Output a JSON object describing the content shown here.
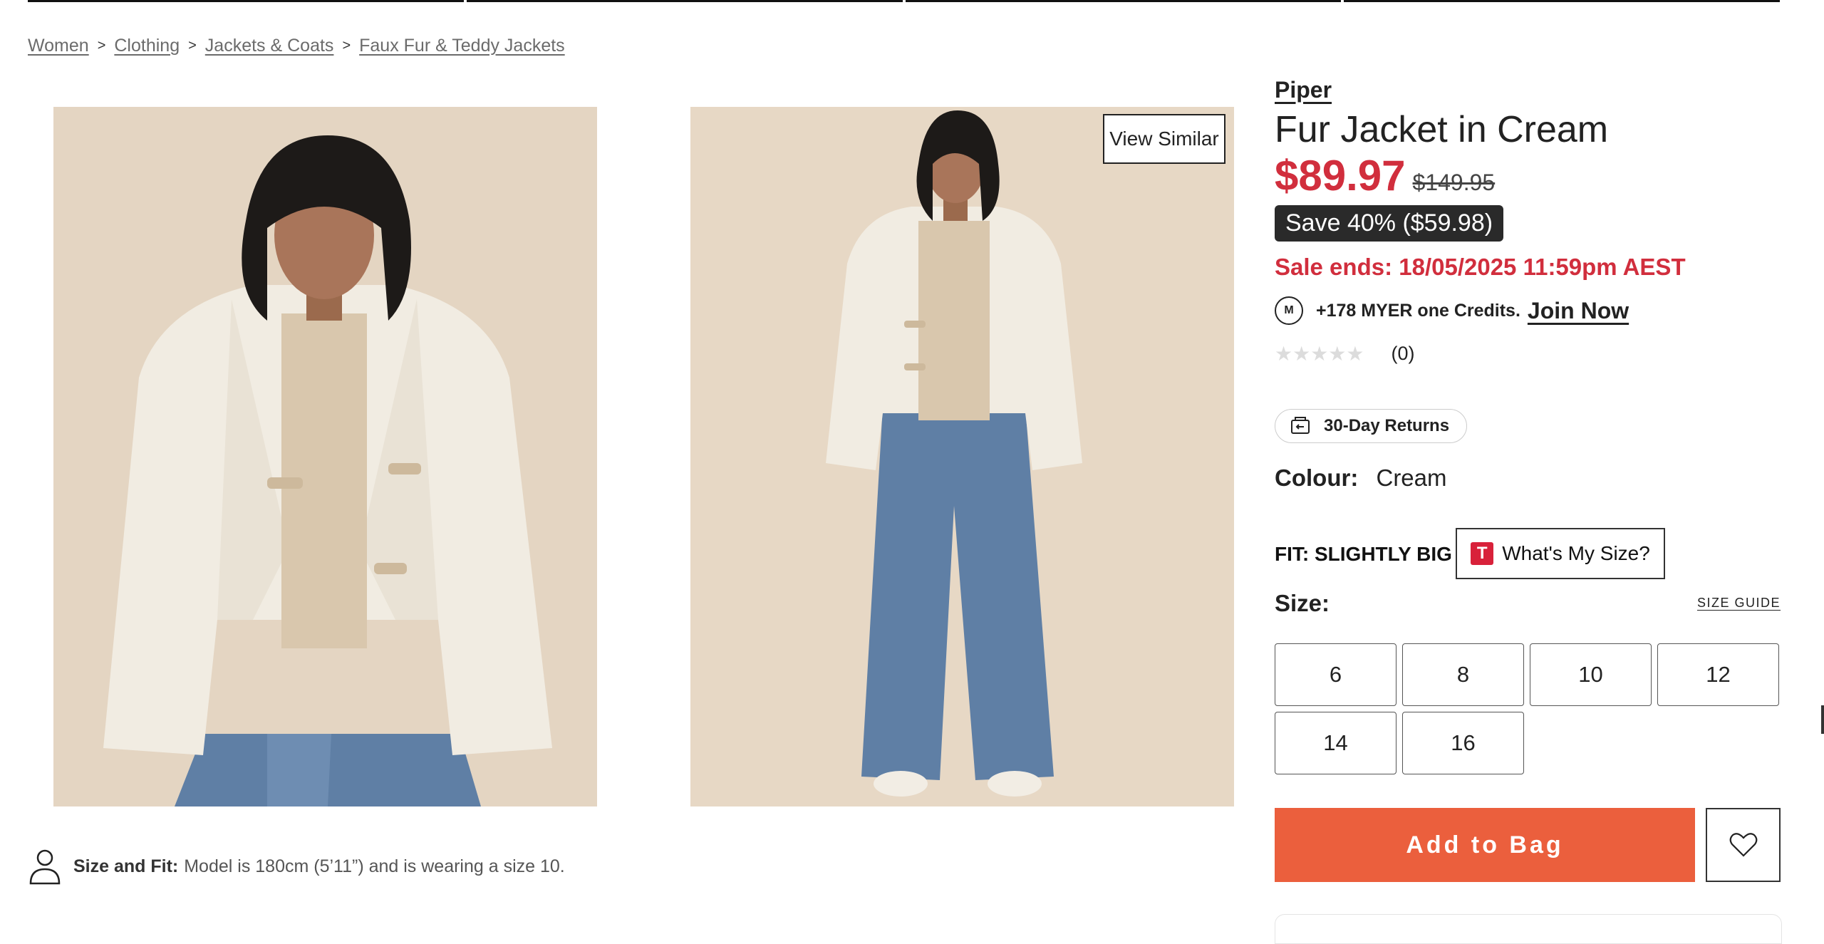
{
  "breadcrumb": {
    "items": [
      "Women",
      "Clothing",
      "Jackets & Coats",
      "Faux Fur & Teddy Jackets"
    ],
    "separator": ">"
  },
  "gallery": {
    "view_similar_label": "View Similar"
  },
  "size_fit_note": {
    "label": "Size and Fit:",
    "text": "Model is 180cm (5’11”) and is wearing a size 10."
  },
  "product": {
    "brand": "Piper",
    "title": "Fur Jacket in Cream",
    "price_now": "$89.97",
    "price_was": "$149.95",
    "save_badge": "Save 40% ($59.98)",
    "sale_ends": "Sale ends: 18/05/2025 11:59pm AEST",
    "credits": {
      "logo": "M",
      "amount": "+178 MYER one Credits.",
      "join_label": "Join Now"
    },
    "rating": {
      "stars": "★★★★★",
      "value": 0,
      "max": 5,
      "count": "(0)"
    },
    "returns_label": "30-Day Returns",
    "colour": {
      "label": "Colour:",
      "value": "Cream"
    },
    "fit": {
      "label": "FIT: SLIGHTLY BIG",
      "whats_my_size_logo": "T",
      "whats_my_size_label": "What's My Size?"
    },
    "size": {
      "label": "Size:",
      "guide_label": "SIZE GUIDE",
      "options": [
        "6",
        "8",
        "10",
        "12",
        "14",
        "16"
      ]
    },
    "add_to_bag_label": "Add to Bag"
  },
  "colors": {
    "price_red": "#d12e3d",
    "cta_orange": "#eb5f3d",
    "badge_dark": "#2a2a2a",
    "photo_backdrop": "#e7d8c5"
  },
  "icons": [
    "chevron-right-icon",
    "person-outline-icon",
    "m-logo-icon",
    "returns-icon",
    "star-icon",
    "t-logo-icon",
    "heart-icon"
  ]
}
